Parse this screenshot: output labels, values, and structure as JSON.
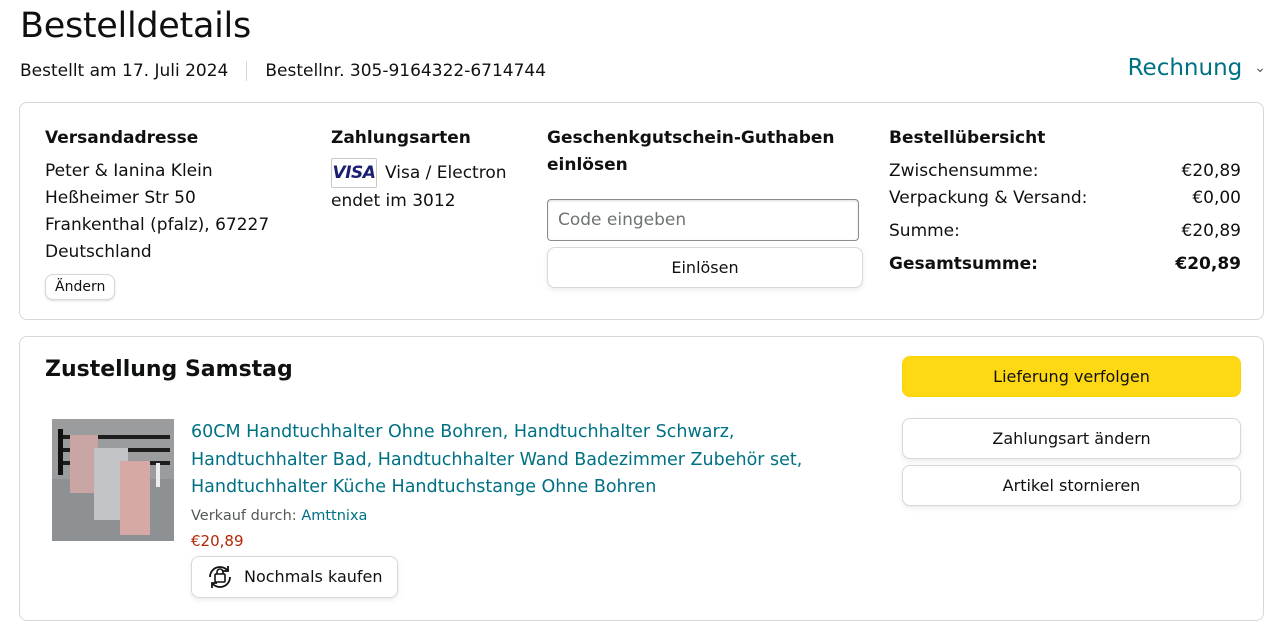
{
  "header": {
    "title": "Bestelldetails",
    "order_date": "Bestellt am 17. Juli 2024",
    "order_number": "Bestellnr. 305-9164322-6714744",
    "invoice_label": "Rechnung"
  },
  "address": {
    "heading": "Versandadresse",
    "lines": [
      "Peter & Ianina Klein",
      "Heßheimer Str 50",
      "Frankenthal (pfalz), 67227",
      "Deutschland"
    ],
    "change_label": "Ändern"
  },
  "payment": {
    "heading": "Zahlungsarten",
    "card_brand": "VISA",
    "card_type": "Visa / Electron",
    "card_ending": "endet im 3012"
  },
  "gift": {
    "heading_line1": "Geschenkgutschein-Guthaben",
    "heading_line2": "einlösen",
    "placeholder": "Code eingeben",
    "redeem_label": "Einlösen"
  },
  "summary": {
    "heading": "Bestellübersicht",
    "rows": [
      {
        "label": "Zwischensumme:",
        "value": "€20,89"
      },
      {
        "label": "Verpackung & Versand:",
        "value": "€0,00"
      },
      {
        "label": "Summe:",
        "value": "€20,89"
      },
      {
        "label": "Gesamtsumme:",
        "value": "€20,89"
      }
    ]
  },
  "delivery": {
    "title": "Zustellung Samstag",
    "product": {
      "name_line1": "60CM Handtuchhalter Ohne Bohren, Handtuchhalter Schwarz,",
      "name_line2": "Handtuchhalter Bad, Handtuchhalter Wand Badezimmer Zubehör set,",
      "name_line3": "Handtuchhalter Küche Handtuchstange Ohne Bohren",
      "seller_prefix": "Verkauf durch:",
      "seller_name": "Amttnixa",
      "price": "€20,89",
      "buy_again_label": "Nochmals kaufen"
    },
    "actions": {
      "track_label": "Lieferung verfolgen",
      "change_payment_label": "Zahlungsart ändern",
      "cancel_label": "Artikel stornieren"
    }
  },
  "colors": {
    "link": "#007185",
    "price": "#b12704",
    "primary_button": "#ffd814"
  }
}
